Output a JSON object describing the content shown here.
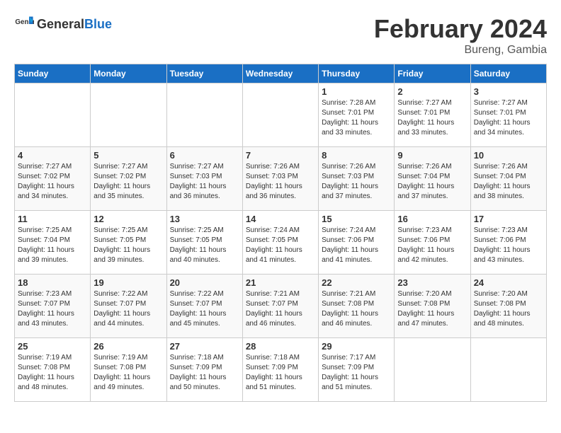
{
  "header": {
    "logo_general": "General",
    "logo_blue": "Blue",
    "month_year": "February 2024",
    "location": "Bureng, Gambia"
  },
  "days_of_week": [
    "Sunday",
    "Monday",
    "Tuesday",
    "Wednesday",
    "Thursday",
    "Friday",
    "Saturday"
  ],
  "weeks": [
    [
      {
        "day": "",
        "info": ""
      },
      {
        "day": "",
        "info": ""
      },
      {
        "day": "",
        "info": ""
      },
      {
        "day": "",
        "info": ""
      },
      {
        "day": "1",
        "info": "Sunrise: 7:28 AM\nSunset: 7:01 PM\nDaylight: 11 hours\nand 33 minutes."
      },
      {
        "day": "2",
        "info": "Sunrise: 7:27 AM\nSunset: 7:01 PM\nDaylight: 11 hours\nand 33 minutes."
      },
      {
        "day": "3",
        "info": "Sunrise: 7:27 AM\nSunset: 7:01 PM\nDaylight: 11 hours\nand 34 minutes."
      }
    ],
    [
      {
        "day": "4",
        "info": "Sunrise: 7:27 AM\nSunset: 7:02 PM\nDaylight: 11 hours\nand 34 minutes."
      },
      {
        "day": "5",
        "info": "Sunrise: 7:27 AM\nSunset: 7:02 PM\nDaylight: 11 hours\nand 35 minutes."
      },
      {
        "day": "6",
        "info": "Sunrise: 7:27 AM\nSunset: 7:03 PM\nDaylight: 11 hours\nand 36 minutes."
      },
      {
        "day": "7",
        "info": "Sunrise: 7:26 AM\nSunset: 7:03 PM\nDaylight: 11 hours\nand 36 minutes."
      },
      {
        "day": "8",
        "info": "Sunrise: 7:26 AM\nSunset: 7:03 PM\nDaylight: 11 hours\nand 37 minutes."
      },
      {
        "day": "9",
        "info": "Sunrise: 7:26 AM\nSunset: 7:04 PM\nDaylight: 11 hours\nand 37 minutes."
      },
      {
        "day": "10",
        "info": "Sunrise: 7:26 AM\nSunset: 7:04 PM\nDaylight: 11 hours\nand 38 minutes."
      }
    ],
    [
      {
        "day": "11",
        "info": "Sunrise: 7:25 AM\nSunset: 7:04 PM\nDaylight: 11 hours\nand 39 minutes."
      },
      {
        "day": "12",
        "info": "Sunrise: 7:25 AM\nSunset: 7:05 PM\nDaylight: 11 hours\nand 39 minutes."
      },
      {
        "day": "13",
        "info": "Sunrise: 7:25 AM\nSunset: 7:05 PM\nDaylight: 11 hours\nand 40 minutes."
      },
      {
        "day": "14",
        "info": "Sunrise: 7:24 AM\nSunset: 7:05 PM\nDaylight: 11 hours\nand 41 minutes."
      },
      {
        "day": "15",
        "info": "Sunrise: 7:24 AM\nSunset: 7:06 PM\nDaylight: 11 hours\nand 41 minutes."
      },
      {
        "day": "16",
        "info": "Sunrise: 7:23 AM\nSunset: 7:06 PM\nDaylight: 11 hours\nand 42 minutes."
      },
      {
        "day": "17",
        "info": "Sunrise: 7:23 AM\nSunset: 7:06 PM\nDaylight: 11 hours\nand 43 minutes."
      }
    ],
    [
      {
        "day": "18",
        "info": "Sunrise: 7:23 AM\nSunset: 7:07 PM\nDaylight: 11 hours\nand 43 minutes."
      },
      {
        "day": "19",
        "info": "Sunrise: 7:22 AM\nSunset: 7:07 PM\nDaylight: 11 hours\nand 44 minutes."
      },
      {
        "day": "20",
        "info": "Sunrise: 7:22 AM\nSunset: 7:07 PM\nDaylight: 11 hours\nand 45 minutes."
      },
      {
        "day": "21",
        "info": "Sunrise: 7:21 AM\nSunset: 7:07 PM\nDaylight: 11 hours\nand 46 minutes."
      },
      {
        "day": "22",
        "info": "Sunrise: 7:21 AM\nSunset: 7:08 PM\nDaylight: 11 hours\nand 46 minutes."
      },
      {
        "day": "23",
        "info": "Sunrise: 7:20 AM\nSunset: 7:08 PM\nDaylight: 11 hours\nand 47 minutes."
      },
      {
        "day": "24",
        "info": "Sunrise: 7:20 AM\nSunset: 7:08 PM\nDaylight: 11 hours\nand 48 minutes."
      }
    ],
    [
      {
        "day": "25",
        "info": "Sunrise: 7:19 AM\nSunset: 7:08 PM\nDaylight: 11 hours\nand 48 minutes."
      },
      {
        "day": "26",
        "info": "Sunrise: 7:19 AM\nSunset: 7:08 PM\nDaylight: 11 hours\nand 49 minutes."
      },
      {
        "day": "27",
        "info": "Sunrise: 7:18 AM\nSunset: 7:09 PM\nDaylight: 11 hours\nand 50 minutes."
      },
      {
        "day": "28",
        "info": "Sunrise: 7:18 AM\nSunset: 7:09 PM\nDaylight: 11 hours\nand 51 minutes."
      },
      {
        "day": "29",
        "info": "Sunrise: 7:17 AM\nSunset: 7:09 PM\nDaylight: 11 hours\nand 51 minutes."
      },
      {
        "day": "",
        "info": ""
      },
      {
        "day": "",
        "info": ""
      }
    ]
  ]
}
